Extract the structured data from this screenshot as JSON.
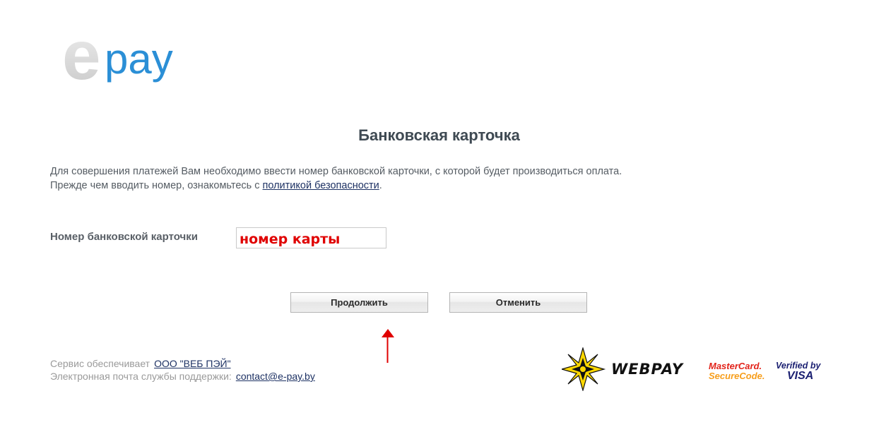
{
  "logo": {
    "text": "epay",
    "letter_e": "e",
    "letters_pay": "pay"
  },
  "page": {
    "title": "Банковская карточка",
    "intro_line1": "Для совершения платежей Вам необходимо ввести номер банковской карточки, с которой будет производиться оплата.",
    "intro_line2_prefix": "Прежде чем вводить номер, ознакомьтесь с ",
    "policy_link": "политикой безопасности",
    "intro_line2_suffix": "."
  },
  "form": {
    "card_label": "Номер банковской карточки",
    "card_value": "номер карты"
  },
  "buttons": {
    "continue": "Продолжить",
    "cancel": "Отменить"
  },
  "annotation": {
    "icon": "red-arrow-up-icon",
    "color": "#e00000"
  },
  "footer": {
    "provider_label": "Сервис обеспечивает",
    "provider_link": "ООО \"ВЕБ ПЭЙ\"",
    "support_label": "Электронная почта службы поддержки:",
    "support_email": "contact@e-pay.by"
  },
  "badges": {
    "webpay": "WEBPAY",
    "mastercard_line1": "MasterCard.",
    "mastercard_line2": "SecureCode.",
    "visa_line1": "Verified by",
    "visa_line2": "VISA"
  },
  "colors": {
    "accent_blue": "#2b8fd6",
    "logo_grey": "#d9d9d9",
    "text_dark": "#3f4a53",
    "link": "#1e3264",
    "mastercard_red": "#e2231a",
    "mastercard_orange": "#f79e1b",
    "visa_blue": "#1a1f71",
    "webpay_star_yellow": "#ffd800"
  }
}
